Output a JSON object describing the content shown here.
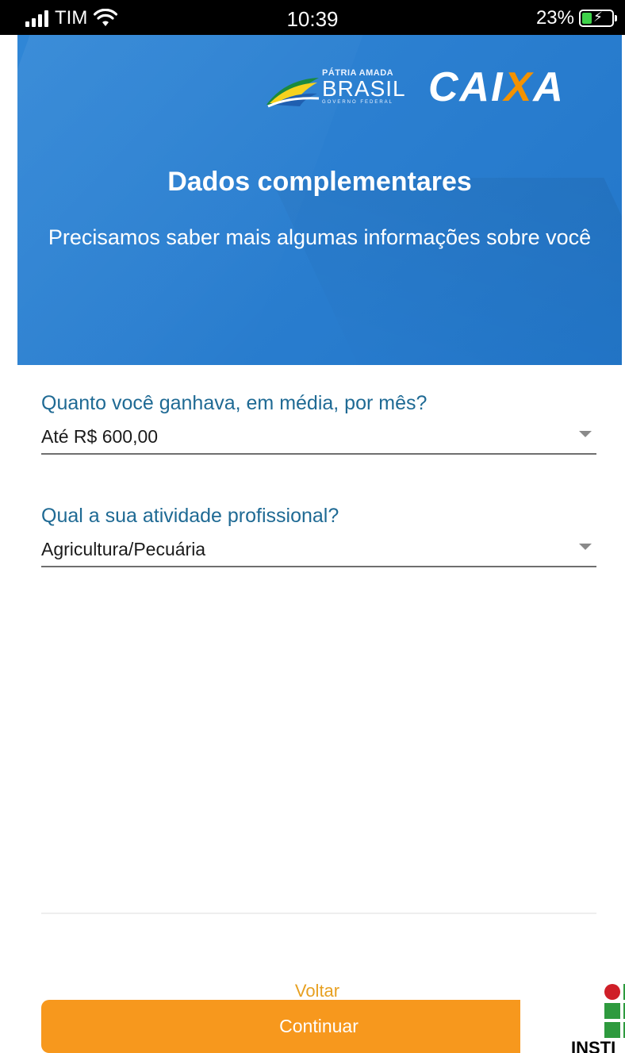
{
  "status_bar": {
    "carrier": "TIM",
    "time": "10:39",
    "battery": "23%",
    "icons": [
      "signal-icon",
      "wifi-icon",
      "battery-charging-icon"
    ]
  },
  "header": {
    "brasil_logo": {
      "line1": "PÁTRIA AMADA",
      "line2": "BRASIL",
      "line3": "GOVERNO FEDERAL"
    },
    "caixa_logo": {
      "part1": "CAI",
      "part2": "X",
      "part3": "A"
    },
    "title": "Dados complementares",
    "subtitle": "Precisamos saber mais algumas informações sobre você"
  },
  "form": {
    "income": {
      "label": "Quanto você ganhava, em média, por mês?",
      "value": "Até R$ 600,00"
    },
    "occupation": {
      "label": "Qual a sua atividade profissional?",
      "value": "Agricultura/Pecuária"
    }
  },
  "footer": {
    "back_label": "Voltar",
    "continue_label": "Continuar"
  },
  "overlay_logo": {
    "text": "INSTI"
  },
  "colors": {
    "hero_blue": "#2b7fd0",
    "label_blue": "#1f6a94",
    "orange": "#f7981d",
    "caixa_orange": "#f39200"
  }
}
